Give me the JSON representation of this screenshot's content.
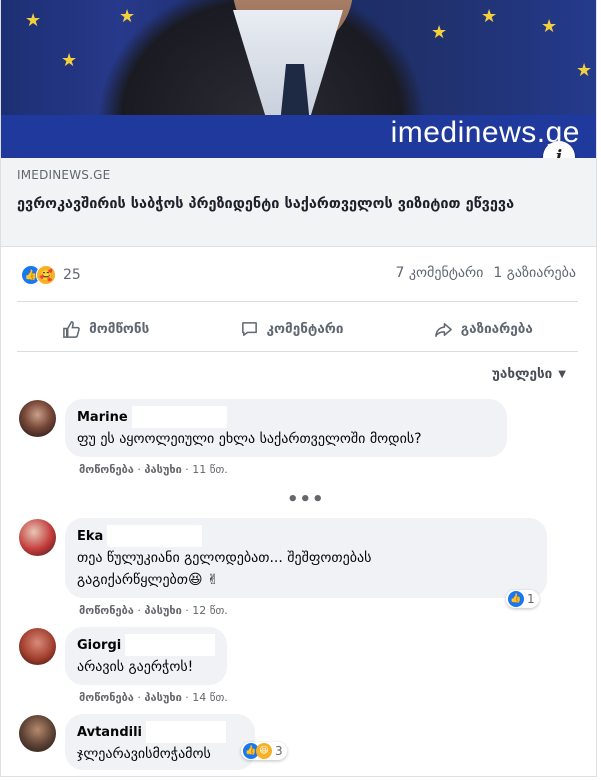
{
  "hero": {
    "brand": "imedinews.ge",
    "info_icon": "i"
  },
  "link": {
    "domain": "IMEDINEWS.GE",
    "headline": "ევროკავშირის საბჭოს პრეზიდენტი საქართველოს ვიზიტით ეწვევა"
  },
  "stats": {
    "reactions": "25",
    "comments": "7 კომენტარი",
    "shares": "1 გაზიარება"
  },
  "actions": {
    "like": "მომწონს",
    "comment": "კომენტარი",
    "share": "გაზიარება"
  },
  "sort": {
    "label": "უახლესი"
  },
  "comments": [
    {
      "author": "Marine",
      "text": "ფუ ეს აყოოლეიული ეხლა საქართველოში მოდის?",
      "like": "მოწონება",
      "reply": "პასუხი",
      "time": "11 წთ."
    },
    {
      "author": "Eka",
      "text": "თეა წულუკიანი გელოდებათ... შეშფოთებას გაგიქარწყლებთ😆 ✌",
      "like": "მოწონება",
      "reply": "პასუხი",
      "time": "12 წთ.",
      "reactions": "1"
    },
    {
      "author": "Giorgi",
      "text": "არავის გაერჭოს!",
      "like": "მოწონება",
      "reply": "პასუხი",
      "time": "14 წთ."
    },
    {
      "author": "Avtandili",
      "text": "ჯლეარავისმოჭამოს",
      "like": "",
      "reply": "",
      "time": "",
      "reactions": "3"
    }
  ],
  "more_comments": "•••"
}
